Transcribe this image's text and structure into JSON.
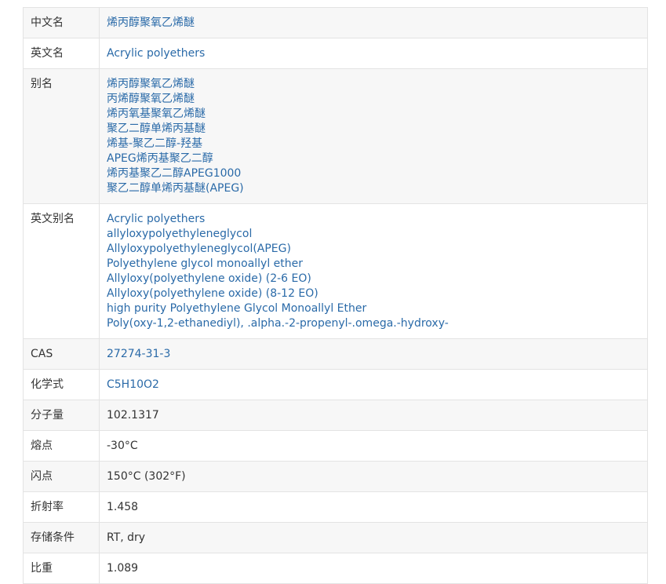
{
  "rows": [
    {
      "label": "中文名",
      "lines": [
        "烯丙醇聚氧乙烯醚"
      ],
      "link": true
    },
    {
      "label": "英文名",
      "lines": [
        "Acrylic polyethers"
      ],
      "link": true
    },
    {
      "label": "别名",
      "lines": [
        "烯丙醇聚氧乙烯醚",
        "丙烯醇聚氧乙烯醚",
        "烯丙氧基聚氧乙烯醚",
        "聚乙二醇单烯丙基醚",
        "烯基-聚乙二醇-羟基",
        "APEG烯丙基聚乙二醇",
        "烯丙基聚乙二醇APEG1000",
        "聚乙二醇单烯丙基醚(APEG)"
      ],
      "link": true
    },
    {
      "label": "英文别名",
      "lines": [
        "Acrylic polyethers",
        "allyloxypolyethyleneglycol",
        "Allyloxypolyethyleneglycol(APEG)",
        "Polyethylene glycol monoallyl ether",
        "Allyloxy(polyethylene oxide) (2-6 EO)",
        "Allyloxy(polyethylene oxide) (8-12 EO)",
        "high purity Polyethylene Glycol Monoallyl Ether",
        "Poly(oxy-1,2-ethanediyl), .alpha.-2-propenyl-.omega.-hydroxy-"
      ],
      "link": true
    },
    {
      "label": "CAS",
      "lines": [
        "27274-31-3"
      ],
      "link": true
    },
    {
      "label": "化学式",
      "lines": [
        "C5H10O2"
      ],
      "link": true
    },
    {
      "label": "分子量",
      "lines": [
        "102.1317"
      ],
      "link": false
    },
    {
      "label": "熔点",
      "lines": [
        "-30°C"
      ],
      "link": false
    },
    {
      "label": "闪点",
      "lines": [
        "150°C (302°F)"
      ],
      "link": false
    },
    {
      "label": "折射率",
      "lines": [
        "1.458"
      ],
      "link": false
    },
    {
      "label": "存储条件",
      "lines": [
        "RT, dry"
      ],
      "link": false
    },
    {
      "label": "比重",
      "lines": [
        "1.089"
      ],
      "link": false
    }
  ]
}
